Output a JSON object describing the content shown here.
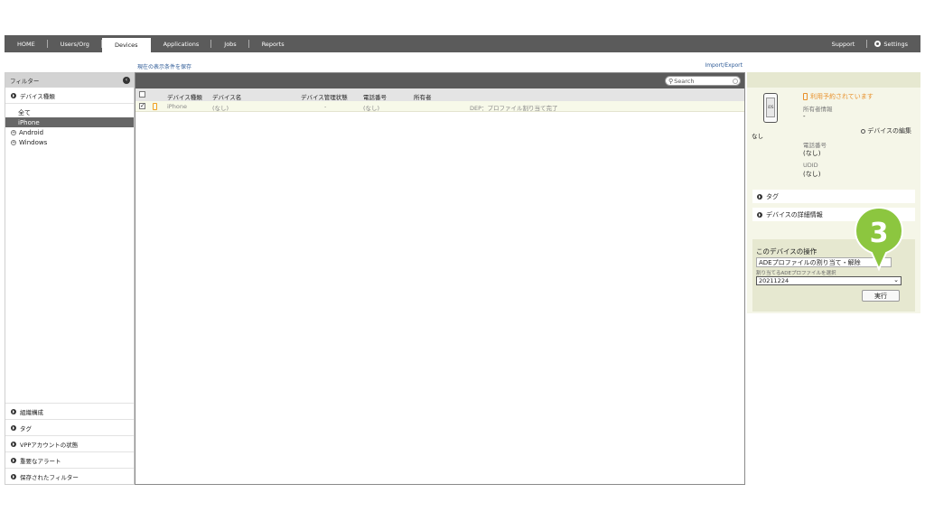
{
  "nav": {
    "items": [
      "HOME",
      "Users/Org",
      "Devices",
      "Applications",
      "Jobs",
      "Reports"
    ],
    "active": "Devices",
    "support": "Support",
    "settings": "Settings"
  },
  "subbar": {
    "save_view": "現在の表示条件を保存",
    "import_export": "Import/Export"
  },
  "filter": {
    "title": "フィルター",
    "device_type_section": "デバイス種類",
    "tree": {
      "all": "全て",
      "iphone": "iPhone",
      "android": "Android",
      "windows": "Windows"
    },
    "bottom": [
      "組織構成",
      "タグ",
      "VPPアカウントの状態",
      "重要なアラート",
      "保存されたフィルター"
    ]
  },
  "list": {
    "search_placeholder": "Search",
    "columns": {
      "type": "デバイス種類",
      "name": "デバイス名",
      "mgmt": "デバイス管理状態",
      "phone": "電話番号",
      "owner": "所有者"
    },
    "rows": [
      {
        "type": "iPhone",
        "name": "(なし)",
        "mgmt": "-",
        "phone": "(なし)",
        "status": "DEP：プロファイル割り当て完了"
      }
    ]
  },
  "detail": {
    "device_name": "なし",
    "device_os_label": "iOS",
    "status": "利用予約されています",
    "owner_label": "所有者情報",
    "owner_value": "-",
    "edit": "デバイスの編集",
    "phone_label": "電話番号",
    "phone_value": "(なし)",
    "udid_label": "UDID",
    "udid_value": "(なし)",
    "tag_section": "タグ",
    "detail_section": "デバイスの詳細情報",
    "ops_title": "このデバイスの操作",
    "ops_select": "ADEプロファイルの割り当て・解除",
    "ops_label": "割り当てるADEプロファイルを選択",
    "profile_value": "20211224",
    "run": "実行"
  },
  "callout": {
    "number": "3",
    "color": "#8cc63f"
  }
}
